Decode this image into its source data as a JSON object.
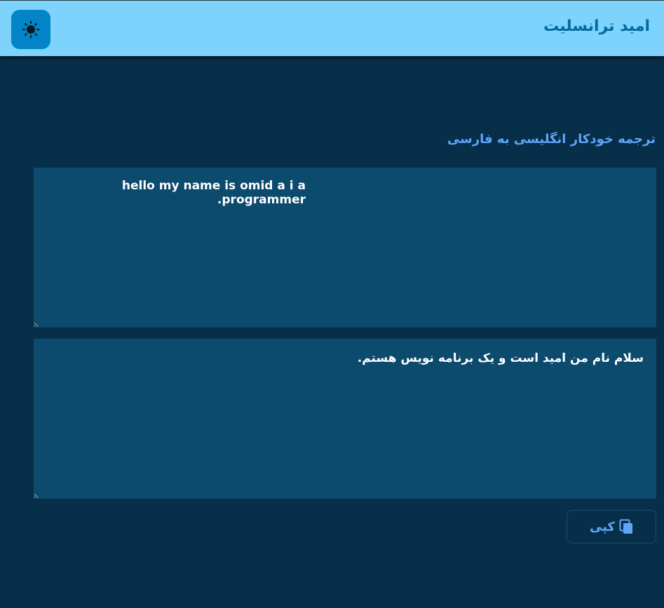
{
  "header": {
    "title": "امید ترانسلیت",
    "theme_toggle_icon": "sun-icon"
  },
  "main": {
    "subtitle": "ترجمه خودکار انگلیسی به فارسی",
    "source_text": "hello my name is omid a i a programmer.",
    "translated_text": "سلام نام من امید است و یک برنامه نویس هستم.",
    "copy_button": {
      "label": "کپی",
      "icon": "copy-icon"
    }
  },
  "colors": {
    "header_bg": "#7dd3fc",
    "title": "#0369a1",
    "toggle_bg": "#0284c7",
    "page_bg": "#072f49",
    "textbox_bg": "#0c4a6e",
    "accent": "#60a5fa"
  }
}
